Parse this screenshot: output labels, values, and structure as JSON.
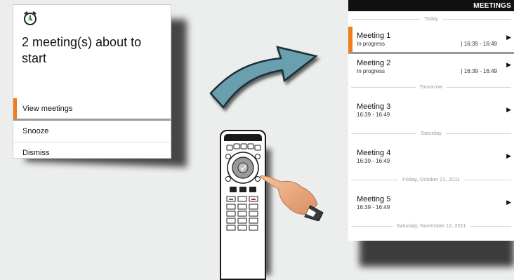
{
  "popup": {
    "icon": "alarm-clock-icon",
    "message": "2 meeting(s) about to start",
    "menu": [
      {
        "label": "View meetings",
        "selected": true
      },
      {
        "label": "Snooze",
        "selected": false
      },
      {
        "label": "Dismiss",
        "selected": false
      }
    ]
  },
  "meetings": {
    "header": "MEETINGS",
    "groups": [
      {
        "label": "Today",
        "items": [
          {
            "title": "Meeting 1",
            "sub": "In progress",
            "time": "| 16:39 - 16:49",
            "active": true
          },
          {
            "title": "Meeting 2",
            "sub": "In progress",
            "time": "| 16:39 - 16:49",
            "active": false
          }
        ]
      },
      {
        "label": "Tomorrow",
        "items": [
          {
            "title": "Meeting 3",
            "sub": "16:39 - 16:49",
            "time": "",
            "active": false
          }
        ]
      },
      {
        "label": "Saturday",
        "items": [
          {
            "title": "Meeting 4",
            "sub": "16:39 - 16:49",
            "time": "",
            "active": false
          }
        ]
      },
      {
        "label": "Friday, October 21, 2011",
        "items": [
          {
            "title": "Meeting 5",
            "sub": "16:39 - 16:49",
            "time": "",
            "active": false
          }
        ]
      },
      {
        "label": "Saturday, November 12, 2011",
        "items": []
      }
    ]
  },
  "colors": {
    "accent": "#f07c1e",
    "header_bg": "#111111",
    "arrow": "#6a9fb0"
  }
}
